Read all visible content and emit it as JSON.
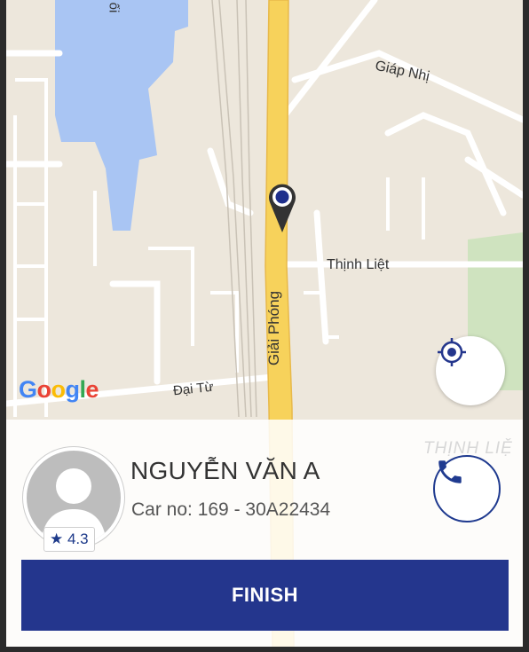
{
  "map": {
    "labels": {
      "giap_nhi": "Giáp Nhị",
      "thinh_liet": "Thịnh Liệt",
      "giai_phong": "Giải Phóng",
      "dai_tu": "Đại Từ",
      "thinh_liet_faded": "THỊNH LIỆ",
      "top_fragment": "ối"
    },
    "google": [
      "G",
      "o",
      "o",
      "g",
      "l",
      "e"
    ],
    "google_colors": [
      "#4285F4",
      "#EA4335",
      "#FBBC05",
      "#4285F4",
      "#34A853",
      "#EA4335"
    ]
  },
  "driver": {
    "name": "NGUYỄN VĂN A",
    "car": "Car no: 169 - 30A22434",
    "rating": "★ 4.3"
  },
  "actions": {
    "finish": "FINISH"
  },
  "colors": {
    "accent": "#24368d",
    "pin": "#1e2f8c"
  }
}
